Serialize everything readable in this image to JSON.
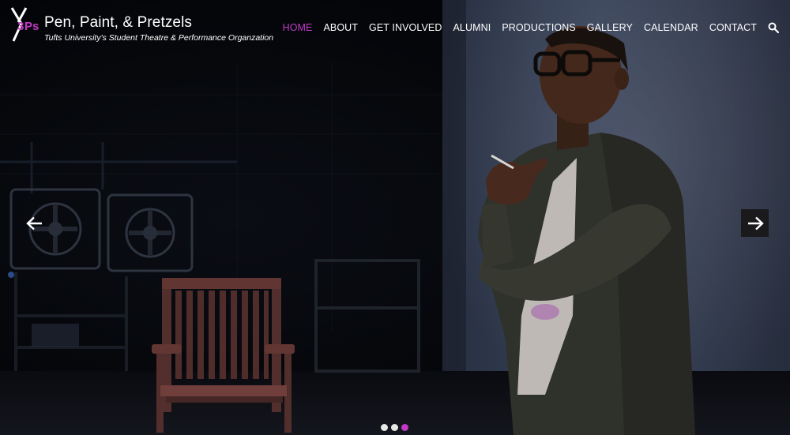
{
  "site": {
    "logo_text": "3Ps",
    "title": "Pen, Paint, & Pretzels",
    "tagline": "Tufts University's Student Theatre & Performance Organzation"
  },
  "nav": {
    "items": [
      {
        "label": "HOME",
        "active": true
      },
      {
        "label": "ABOUT",
        "active": false
      },
      {
        "label": "GET INVOLVED",
        "active": false
      },
      {
        "label": "ALUMNI",
        "active": false
      },
      {
        "label": "PRODUCTIONS",
        "active": false
      },
      {
        "label": "GALLERY",
        "active": false
      },
      {
        "label": "CALENDAR",
        "active": false
      },
      {
        "label": "CONTACT",
        "active": false
      }
    ],
    "search_icon": "search-icon"
  },
  "slider": {
    "prev_icon": "arrow-left-icon",
    "next_icon": "arrow-right-icon",
    "slide_count": 3,
    "active_slide": 3
  },
  "colors": {
    "accent": "#c23ac4",
    "text": "#ffffff",
    "arrow_bg": "#1a1a1c"
  }
}
